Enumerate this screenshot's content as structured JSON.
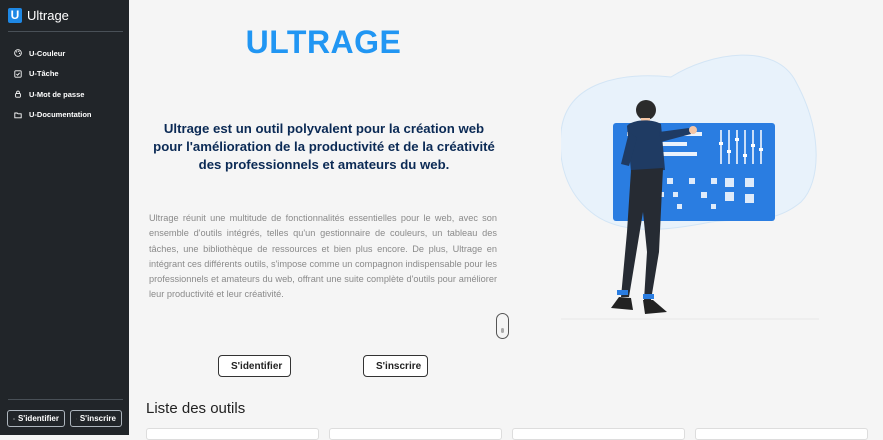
{
  "sidebar": {
    "brand_logo": "U",
    "brand_name": "Ultrage",
    "items": [
      {
        "label": "U-Couleur",
        "icon": "palette-icon"
      },
      {
        "label": "U-Tâche",
        "icon": "checkbox-icon"
      },
      {
        "label": "U-Mot de passe",
        "icon": "lock-icon"
      },
      {
        "label": "U-Documentation",
        "icon": "folder-icon"
      }
    ],
    "login_label": "S'identifier",
    "signup_label": "S'inscrire"
  },
  "main": {
    "title": "ULTRAGE",
    "tagline": "Ultrage est un outil polyvalent pour la création web pour l'amélioration de la productivité et de la créativité des professionnels et amateurs du web.",
    "description": "Ultrage réunit une multitude de fonctionnalités essentielles pour le web, avec son ensemble d'outils intégrés, telles qu'un gestionnaire de couleurs, un tableau des tâches, une bibliothèque de ressources et bien plus encore. De plus, Ultrage en intégrant ces différents outils, s'impose comme un compagnon indispensable pour les professionnels et amateurs du web, offrant une suite complète d'outils pour améliorer leur productivité et leur créativité.",
    "login_label": "S'identifier",
    "signup_label": "S'inscrire",
    "tools_title": "Liste des outils"
  },
  "colors": {
    "accent": "#2196f3",
    "sidebar_bg": "#212529",
    "tagline": "#0b2a55"
  }
}
